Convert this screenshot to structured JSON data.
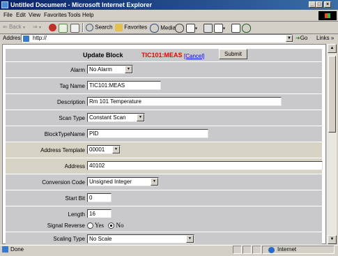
{
  "window": {
    "title": "Untitled Document - Microsoft Internet Explorer"
  },
  "menubar": [
    "File",
    "Edit",
    "View",
    "Favorites",
    "Tools",
    "Help"
  ],
  "toolbar": {
    "back": "Back",
    "search": "Search",
    "favorites": "Favorites",
    "media": "Media"
  },
  "address": {
    "label": "Address",
    "value": "http://",
    "go": "Go",
    "links": "Links »"
  },
  "form": {
    "title": "Update Block",
    "tag": "TIC101:MEAS",
    "cancel": "[Cancel]",
    "submit": "Submit",
    "fields": {
      "alarm": {
        "label": "Alarm",
        "value": "No Alarm"
      },
      "tag_name": {
        "label": "Tag Name",
        "value": "TIC101:MEAS"
      },
      "description": {
        "label": "Description",
        "value": "Rm 101 Temperature"
      },
      "scan_type": {
        "label": "Scan Type",
        "value": "Constant Scan"
      },
      "block_type": {
        "label": "BlockTypeName",
        "value": "PID"
      },
      "address_template": {
        "label": "Address Template",
        "value": "00001"
      },
      "address": {
        "label": "Address",
        "value": "40102"
      },
      "conversion_code": {
        "label": "Conversion Code",
        "value": "Unsigned Integer"
      },
      "start_bit": {
        "label": "Start Bit",
        "value": "0"
      },
      "length": {
        "label": "Length",
        "value": "16"
      },
      "signal_reverse": {
        "label": "Signal Reverse",
        "yes": "Yes",
        "no": "No",
        "selected": "No"
      },
      "scaling_type": {
        "label": "Scaling Type",
        "value": "No Scale"
      }
    }
  },
  "status": {
    "text": "Done",
    "zone": "Internet"
  }
}
